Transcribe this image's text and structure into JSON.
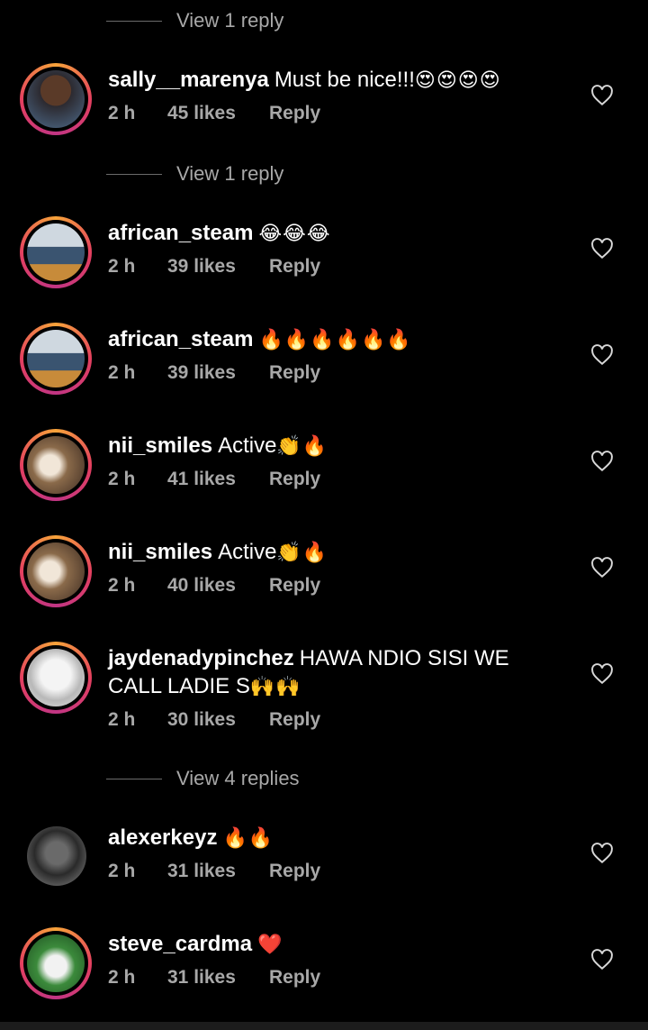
{
  "reply_threads": [
    {
      "label": "View 1 reply"
    },
    {
      "label": "View 1 reply"
    },
    {
      "label": "View 4 replies"
    }
  ],
  "comments": [
    {
      "username": "sally__marenya",
      "text": "Must be nice!!!",
      "emoji": "😍😍😍😍",
      "time": "2 h",
      "likes": "45 likes",
      "reply": "Reply",
      "avatar": "user-photo-avatar"
    },
    {
      "username": "african_steam",
      "text": "",
      "emoji": "😂😂😂",
      "time": "2 h",
      "likes": "39 likes",
      "reply": "Reply",
      "avatar": "user-photo-avatar"
    },
    {
      "username": "african_steam",
      "text": "",
      "emoji": "🔥🔥🔥🔥🔥🔥",
      "time": "2 h",
      "likes": "39 likes",
      "reply": "Reply",
      "avatar": "user-photo-avatar"
    },
    {
      "username": "nii_smiles",
      "text": "Active",
      "emoji": "👏🔥",
      "time": "2 h",
      "likes": "41 likes",
      "reply": "Reply",
      "avatar": "user-photo-avatar"
    },
    {
      "username": "nii_smiles",
      "text": "Active",
      "emoji": "👏🔥",
      "time": "2 h",
      "likes": "40 likes",
      "reply": "Reply",
      "avatar": "user-photo-avatar"
    },
    {
      "username": "jaydenadypinchez",
      "text": "HAWA NDIO SISI WE CALL LADIE S",
      "emoji": "🙌🙌",
      "time": "2 h",
      "likes": "30 likes",
      "reply": "Reply",
      "avatar": "user-photo-avatar"
    },
    {
      "username": "alexerkeyz",
      "text": "",
      "emoji": "🔥🔥",
      "time": "2 h",
      "likes": "31 likes",
      "reply": "Reply",
      "avatar": "user-photo-avatar"
    },
    {
      "username": "steve_cardma",
      "text": "",
      "emoji": "❤️",
      "time": "2 h",
      "likes": "31 likes",
      "reply": "Reply",
      "avatar": "user-photo-avatar"
    }
  ],
  "icons": {
    "like": "heart-outline-icon"
  },
  "colors": {
    "background": "#000000",
    "secondary_text": "#a8a8a8",
    "story_ring": "#e4405f"
  }
}
